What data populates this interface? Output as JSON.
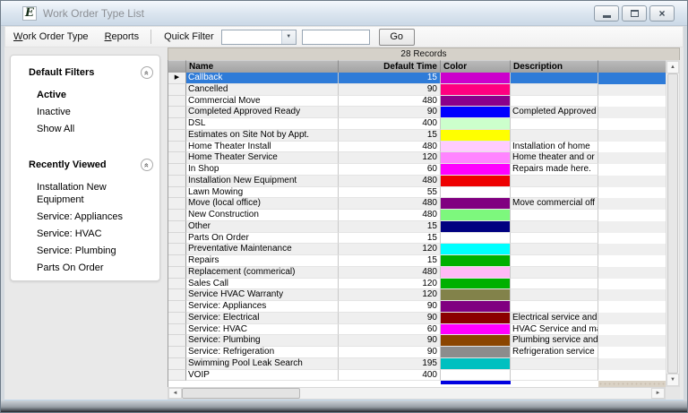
{
  "window": {
    "title": "Work Order Type List",
    "icon_letter": "E"
  },
  "icons": {
    "collapse": "«",
    "combo_arrow": "▼",
    "row_pointer": "▶",
    "scroll_up": "▲",
    "scroll_down": "▼",
    "scroll_left": "◄",
    "scroll_right": "►",
    "close": "×"
  },
  "menu": {
    "work_order_type": {
      "hotkey": "W",
      "rest": "ork Order Type"
    },
    "reports": {
      "hotkey": "R",
      "rest": "eports"
    }
  },
  "quick_filter": {
    "label": "Quick Filter",
    "combo_value": "",
    "input_value": "",
    "go_label": "Go"
  },
  "sidebar": {
    "sections": [
      {
        "title": "Default Filters",
        "items": [
          {
            "label": "Active",
            "bold": true
          },
          {
            "label": "Inactive"
          },
          {
            "label": "Show All"
          }
        ]
      },
      {
        "title": "Recently Viewed",
        "items": [
          {
            "label": "Installation New Equipment"
          },
          {
            "label": "Service: Appliances"
          },
          {
            "label": "Service: HVAC"
          },
          {
            "label": "Service: Plumbing"
          },
          {
            "label": "Parts On Order"
          }
        ]
      }
    ]
  },
  "table": {
    "records_label": "28 Records",
    "columns": {
      "name": "Name",
      "default_time": "Default Time",
      "color": "Color",
      "description": "Description"
    },
    "selection_color": "#2E7BD8",
    "rows": [
      {
        "name": "Callback",
        "time": "15",
        "color": "#CC00CC",
        "description": "",
        "selected": true
      },
      {
        "name": "Cancelled",
        "time": "90",
        "color": "#FF0080",
        "description": ""
      },
      {
        "name": "Commercial Move",
        "time": "480",
        "color": "#8B008B",
        "description": ""
      },
      {
        "name": "Completed Approved Ready",
        "time": "90",
        "color": "#0000FF",
        "description": "Completed Approved"
      },
      {
        "name": "DSL",
        "time": "400",
        "color": "#CCFFCC",
        "description": ""
      },
      {
        "name": "Estimates on Site Not by Appt.",
        "time": "15",
        "color": "#FFFF00",
        "description": ""
      },
      {
        "name": "Home Theater Install",
        "time": "480",
        "color": "#FFCCFF",
        "description": "Installation of home"
      },
      {
        "name": "Home Theater Service",
        "time": "120",
        "color": "#FF85FF",
        "description": "Home theater and or"
      },
      {
        "name": "In Shop",
        "time": "60",
        "color": "#FF00FF",
        "description": "Repairs made here."
      },
      {
        "name": "Installation New Equipment",
        "time": "480",
        "color": "#EE0000",
        "description": ""
      },
      {
        "name": "Lawn Mowing",
        "time": "55",
        "color": "#FFFFFF",
        "description": ""
      },
      {
        "name": "Move (local office)",
        "time": "480",
        "color": "#800080",
        "description": "Move commercial off"
      },
      {
        "name": "New Construction",
        "time": "480",
        "color": "#7DF87D",
        "description": ""
      },
      {
        "name": "Other",
        "time": "15",
        "color": "#000080",
        "description": ""
      },
      {
        "name": "Parts On Order",
        "time": "15",
        "color": "#FFFFFF",
        "description": ""
      },
      {
        "name": "Preventative Maintenance",
        "time": "120",
        "color": "#00FFFF",
        "description": ""
      },
      {
        "name": "Repairs",
        "time": "15",
        "color": "#00B000",
        "description": ""
      },
      {
        "name": "Replacement (commerical)",
        "time": "480",
        "color": "#FFB9F5",
        "description": ""
      },
      {
        "name": "Sales Call",
        "time": "120",
        "color": "#00B000",
        "description": ""
      },
      {
        "name": "Service HVAC Warranty",
        "time": "120",
        "color": "#82824A",
        "description": ""
      },
      {
        "name": "Service: Appliances",
        "time": "90",
        "color": "#800080",
        "description": ""
      },
      {
        "name": "Service: Electrical",
        "time": "90",
        "color": "#8B0000",
        "description": "Electrical service and"
      },
      {
        "name": "Service: HVAC",
        "time": "60",
        "color": "#FF00FF",
        "description": "HVAC Service and ma"
      },
      {
        "name": "Service: Plumbing",
        "time": "90",
        "color": "#8B4500",
        "description": "Plumbing service and"
      },
      {
        "name": "Service: Refrigeration",
        "time": "90",
        "color": "#8C8C8C",
        "description": "Refrigeration service"
      },
      {
        "name": "Swimming Pool Leak Search",
        "time": "195",
        "color": "#00C0C0",
        "description": ""
      },
      {
        "name": "VOIP",
        "time": "400",
        "color": "#FFFFFF",
        "description": ""
      }
    ],
    "partial_row_color": "#0000E0"
  }
}
